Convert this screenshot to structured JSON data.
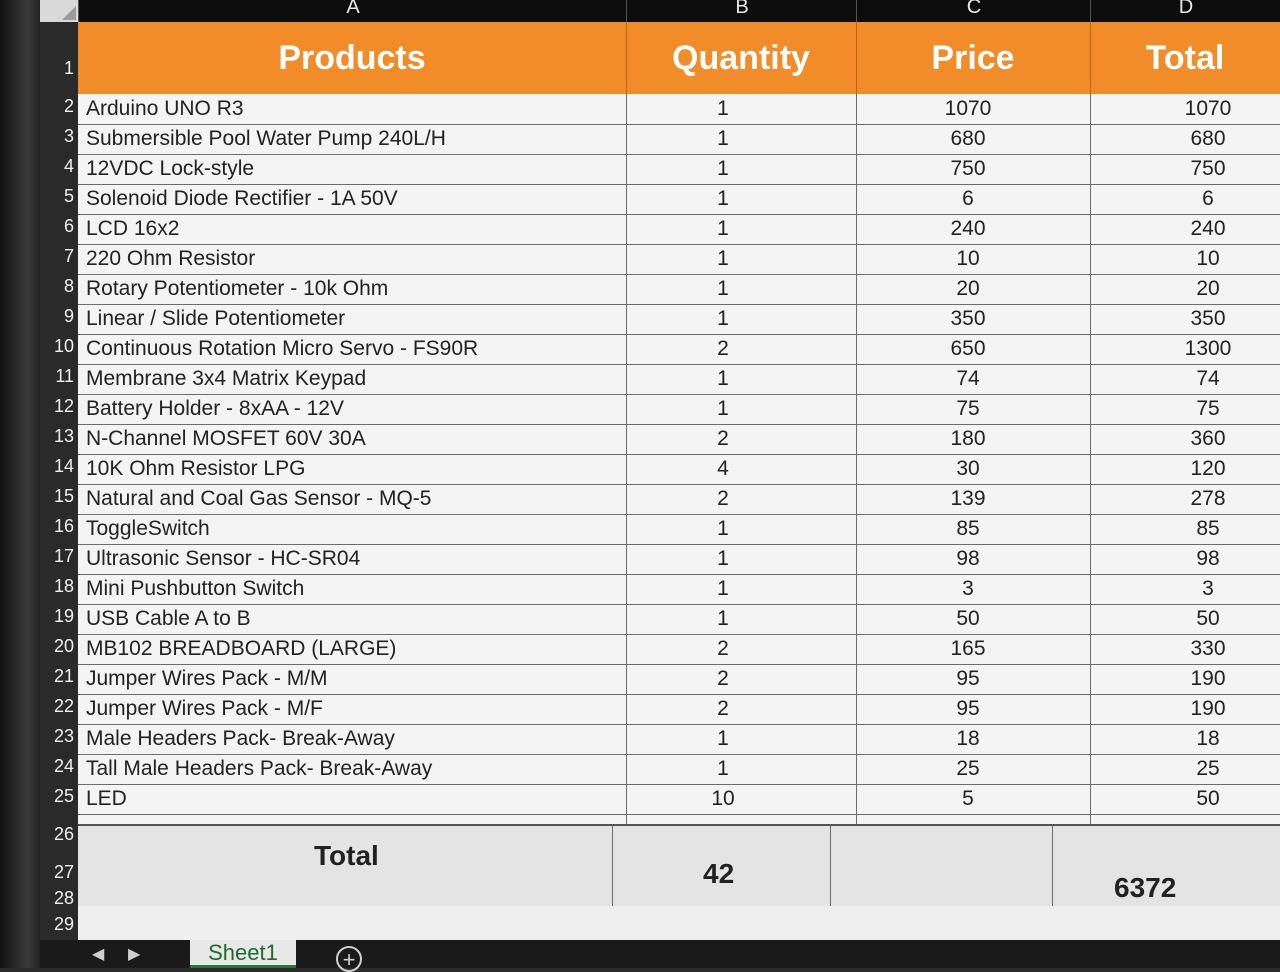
{
  "columns": [
    "A",
    "B",
    "C",
    "D"
  ],
  "header": {
    "products": "Products",
    "quantity": "Quantity",
    "price": "Price",
    "total": "Total"
  },
  "rows": [
    {
      "num": "2",
      "product": "Arduino UNO R3",
      "qty": "1",
      "price": "1070",
      "total": "1070"
    },
    {
      "num": "3",
      "product": "Submersible Pool Water Pump 240L/H",
      "qty": "1",
      "price": "680",
      "total": "680"
    },
    {
      "num": "4",
      "product": "12VDC Lock-style",
      "qty": "1",
      "price": "750",
      "total": "750"
    },
    {
      "num": "5",
      "product": "Solenoid Diode Rectifier - 1A 50V",
      "qty": "1",
      "price": "6",
      "total": "6"
    },
    {
      "num": "6",
      "product": "LCD 16x2",
      "qty": "1",
      "price": "240",
      "total": "240"
    },
    {
      "num": "7",
      "product": "220 Ohm Resistor",
      "qty": "1",
      "price": "10",
      "total": "10"
    },
    {
      "num": "8",
      "product": "Rotary Potentiometer - 10k Ohm",
      "qty": "1",
      "price": "20",
      "total": "20"
    },
    {
      "num": "9",
      "product": "Linear / Slide Potentiometer",
      "qty": "1",
      "price": "350",
      "total": "350"
    },
    {
      "num": "10",
      "product": "Continuous Rotation Micro Servo - FS90R",
      "qty": "2",
      "price": "650",
      "total": "1300"
    },
    {
      "num": "11",
      "product": "Membrane 3x4 Matrix Keypad",
      "qty": "1",
      "price": "74",
      "total": "74"
    },
    {
      "num": "12",
      "product": "Battery Holder - 8xAA - 12V",
      "qty": "1",
      "price": "75",
      "total": "75"
    },
    {
      "num": "13",
      "product": "N-Channel MOSFET 60V 30A",
      "qty": "2",
      "price": "180",
      "total": "360"
    },
    {
      "num": "14",
      "product": "10K Ohm Resistor  LPG",
      "qty": "4",
      "price": "30",
      "total": "120"
    },
    {
      "num": "15",
      "product": "Natural and Coal Gas Sensor - MQ-5",
      "qty": "2",
      "price": "139",
      "total": "278"
    },
    {
      "num": "16",
      "product": "ToggleSwitch",
      "qty": "1",
      "price": "85",
      "total": "85"
    },
    {
      "num": "17",
      "product": "Ultrasonic Sensor - HC-SR04",
      "qty": "1",
      "price": "98",
      "total": "98"
    },
    {
      "num": "18",
      "product": "Mini Pushbutton Switch",
      "qty": "1",
      "price": "3",
      "total": "3"
    },
    {
      "num": "19",
      "product": "USB Cable A to B",
      "qty": "1",
      "price": "50",
      "total": "50"
    },
    {
      "num": "20",
      "product": "MB102 BREADBOARD (LARGE)",
      "qty": "2",
      "price": "165",
      "total": "330"
    },
    {
      "num": "21",
      "product": "Jumper Wires Pack - M/M",
      "qty": "2",
      "price": "95",
      "total": "190"
    },
    {
      "num": "22",
      "product": "Jumper Wires Pack - M/F",
      "qty": "2",
      "price": "95",
      "total": "190"
    },
    {
      "num": "23",
      "product": "Male Headers Pack- Break-Away",
      "qty": "1",
      "price": "18",
      "total": "18"
    },
    {
      "num": "24",
      "product": "Tall Male Headers Pack- Break-Away",
      "qty": "1",
      "price": "25",
      "total": "25"
    },
    {
      "num": "25",
      "product": "LED",
      "qty": "10",
      "price": "5",
      "total": "50"
    }
  ],
  "row_numbers_extra": [
    "1",
    "26",
    "27",
    "28",
    "29"
  ],
  "totals": {
    "label": "Total",
    "quantity": "42",
    "total": "6372"
  },
  "tabs": {
    "sheet_name": "Sheet1",
    "add_icon": "plus-circle-icon"
  },
  "colors": {
    "header_bg": "#f28c28",
    "header_text": "#ffffff",
    "active_tab": "#1e7a33"
  }
}
